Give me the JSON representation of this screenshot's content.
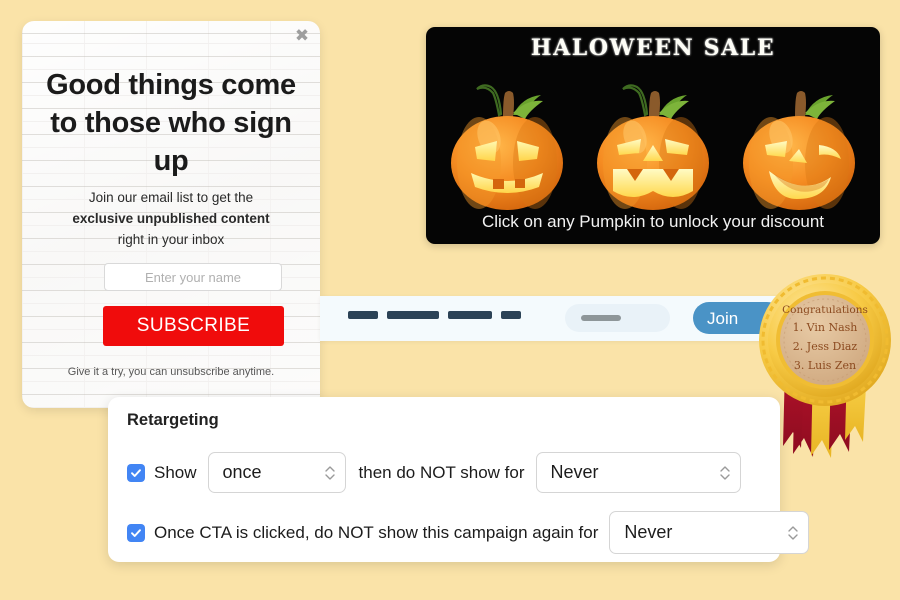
{
  "page": {
    "background_color": "#fae3a8"
  },
  "signup_modal": {
    "close_icon": "close-icon",
    "close_glyph": "✖",
    "headline": "Good things come to those who sign up",
    "sub_line_1": "Join our email list to get the",
    "sub_line_2_bold": "exclusive unpublished content",
    "sub_line_3": "right in your inbox",
    "name_input_placeholder": "Enter your name",
    "subscribe_label": "SUBSCRIBE",
    "subscribe_color": "#f00c0c",
    "footer_note": "Give it a try, you can unsubscribe anytime."
  },
  "halloween_banner": {
    "title": "HALOWEEN SALE",
    "cta_text": "Click on any Pumpkin to unlock your discount",
    "background_color": "#050505",
    "pumpkins": [
      {
        "face": "angry",
        "label": "pumpkin-left"
      },
      {
        "face": "fanged",
        "label": "pumpkin-center"
      },
      {
        "face": "winking",
        "label": "pumpkin-right"
      }
    ]
  },
  "mid_bar": {
    "background_color": "#f4fafd",
    "skeleton_dash_widths": [
      30,
      52,
      44,
      20
    ],
    "input_placeholder_bar": true,
    "join_label": "Join",
    "join_color": "#4a93c6"
  },
  "award_badge": {
    "title": "Congratulations",
    "winners": [
      "1. Vin Nash",
      "2. Jess Diaz",
      "3. Luis Zen"
    ],
    "ribbon_colors": [
      "#c0182b",
      "#f2c53d"
    ],
    "seal_color": "#f6c game"
  },
  "retargeting": {
    "title": "Retargeting",
    "row1": {
      "checked": true,
      "label_before": "Show",
      "select_show_value": "once",
      "label_middle": "then do NOT show for",
      "select_not_show_value": "Never"
    },
    "row2": {
      "checked": true,
      "label": "Once CTA is clicked, do NOT show this campaign again for",
      "select_value": "Never"
    },
    "checkbox_color": "#4285f4"
  }
}
